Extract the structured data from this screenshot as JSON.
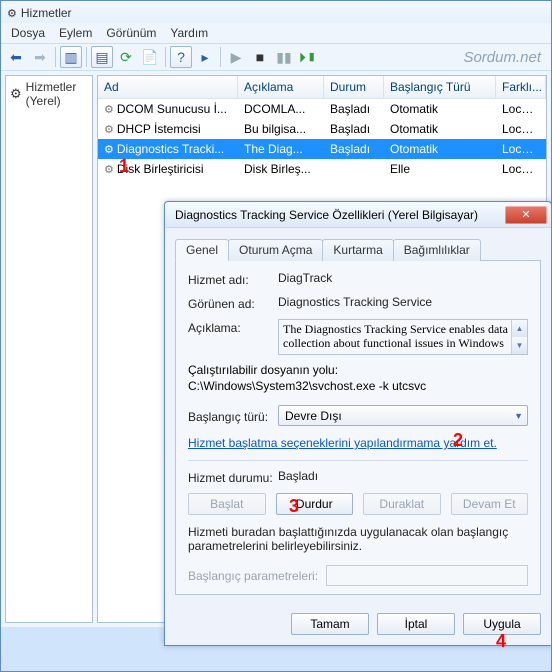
{
  "window": {
    "title": "Hizmetler",
    "watermark": "Sordum.net"
  },
  "menus": [
    "Dosya",
    "Eylem",
    "Görünüm",
    "Yardım"
  ],
  "tree": {
    "root": "Hizmetler (Yerel)"
  },
  "columns": {
    "ad": "Ad",
    "aciklama": "Açıklama",
    "durum": "Durum",
    "baslangic": "Başlangıç Türü",
    "farkli": "Farklı..."
  },
  "rows": [
    {
      "ad": "DCOM Sunucusu İ...",
      "ac": "DCOMLA...",
      "du": "Başladı",
      "ba": "Otomatik",
      "fa": "Local ..."
    },
    {
      "ad": "DHCP İstemcisi",
      "ac": "Bu bilgisa...",
      "du": "Başladı",
      "ba": "Otomatik",
      "fa": "Local ..."
    },
    {
      "ad": "Diagnostics Tracki...",
      "ac": "The Diag...",
      "du": "Başladı",
      "ba": "Otomatik",
      "fa": "Local ..."
    },
    {
      "ad": "Disk Birleştiricisi",
      "ac": "Disk Birleş...",
      "du": "",
      "ba": "Elle",
      "fa": "Local ..."
    }
  ],
  "dialog": {
    "title": "Diagnostics Tracking Service Özellikleri (Yerel Bilgisayar)",
    "tabs": [
      "Genel",
      "Oturum Açma",
      "Kurtarma",
      "Bağımlılıklar"
    ],
    "labels": {
      "hizmet_adi": "Hizmet adı:",
      "gorunen_ad": "Görünen ad:",
      "aciklama": "Açıklama:",
      "yol_label": "Çalıştırılabilir dosyanın yolu:",
      "baslangic": "Başlangıç türü:",
      "durum": "Hizmet durumu:",
      "params": "Başlangıç parametreleri:"
    },
    "values": {
      "hizmet_adi": "DiagTrack",
      "gorunen_ad": "Diagnostics Tracking Service",
      "aciklama": "The Diagnostics Tracking Service enables data collection about functional issues in Windows",
      "yol": "C:\\Windows\\System32\\svchost.exe -k utcsvc",
      "baslangic": "Devre Dışı",
      "durum": "Başladı"
    },
    "link": "Hizmet başlatma seçeneklerini yapılandırmama yardım et.",
    "buttons": {
      "start": "Başlat",
      "stop": "Durdur",
      "pause": "Duraklat",
      "resume": "Devam Et"
    },
    "note": "Hizmeti buradan başlattığınızda uygulanacak olan başlangıç parametrelerini belirleyebilirsiniz.",
    "footer": {
      "ok": "Tamam",
      "cancel": "İptal",
      "apply": "Uygula"
    }
  },
  "annotations": {
    "1": "1",
    "2": "2",
    "3": "3",
    "4": "4"
  }
}
